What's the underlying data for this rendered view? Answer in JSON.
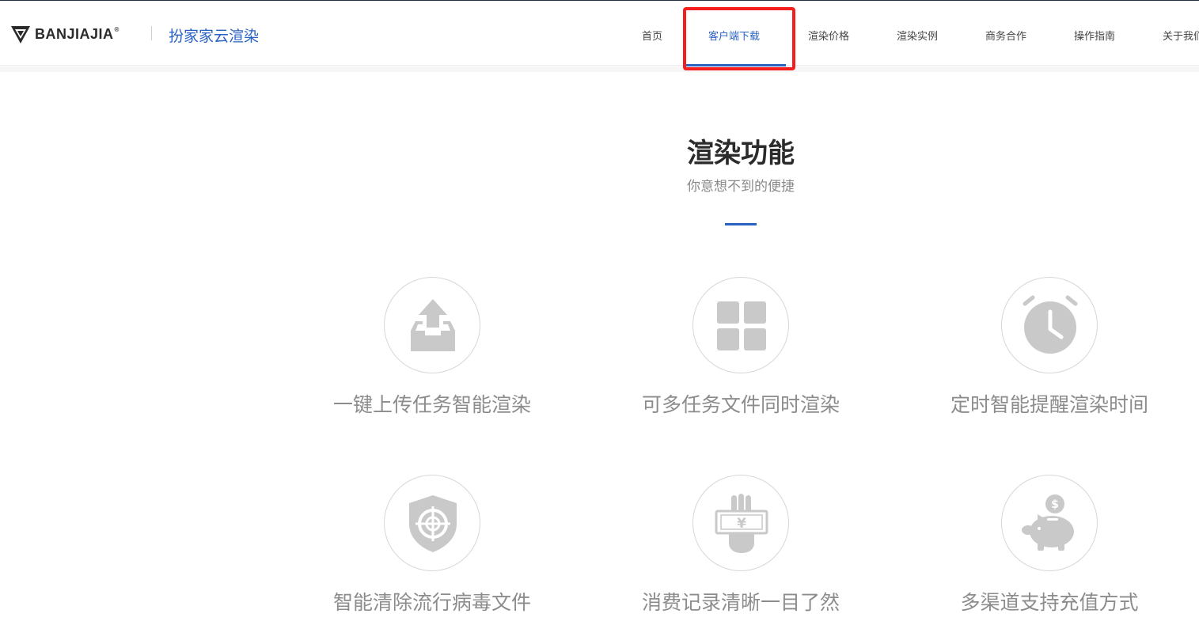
{
  "header": {
    "logo_text": "BANJIAJIA",
    "logo_reg": "®",
    "brand_name": "扮家家云渲染",
    "nav": [
      {
        "label": "首页"
      },
      {
        "label": "客户端下载",
        "active": true
      },
      {
        "label": "渲染价格"
      },
      {
        "label": "渲染实例"
      },
      {
        "label": "商务合作"
      },
      {
        "label": "操作指南"
      },
      {
        "label": "关于我们"
      }
    ]
  },
  "section": {
    "title": "渲染功能",
    "subtitle": "你意想不到的便捷"
  },
  "features": [
    {
      "label": "一键上传任务智能渲染",
      "icon": "upload-tray-icon"
    },
    {
      "label": "可多任务文件同时渲染",
      "icon": "grid-icon"
    },
    {
      "label": "定时智能提醒渲染时间",
      "icon": "alarm-clock-icon"
    },
    {
      "label": "智能清除流行病毒文件",
      "icon": "shield-target-icon"
    },
    {
      "label": "消费记录清晰一目了然",
      "icon": "hand-yuan-bill-icon"
    },
    {
      "label": "多渠道支持充值方式",
      "icon": "piggy-bank-icon"
    }
  ],
  "colors": {
    "accent": "#2a62c4",
    "highlight": "#f41e1e",
    "icon_gray": "#c9c9c9",
    "label_gray": "#8c8c8c"
  }
}
